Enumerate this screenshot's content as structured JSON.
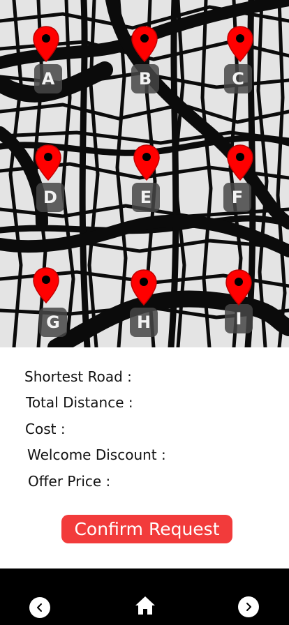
{
  "map": {
    "pins": [
      {
        "id": "a",
        "label": "A"
      },
      {
        "id": "b",
        "label": "B"
      },
      {
        "id": "c",
        "label": "C"
      },
      {
        "id": "d",
        "label": "D"
      },
      {
        "id": "e",
        "label": "E"
      },
      {
        "id": "f",
        "label": "F"
      },
      {
        "id": "g",
        "label": "G"
      },
      {
        "id": "h",
        "label": "H"
      },
      {
        "id": "i",
        "label": "I"
      }
    ],
    "pin_color": "#ff0000"
  },
  "info": {
    "shortest_road": "Shortest Road :",
    "total_distance": "Total Distance :",
    "cost": "Cost :",
    "welcome_discount": "Welcome Discount :",
    "offer_price": "Offer Price :"
  },
  "confirm_button": {
    "label": "Confirm Request",
    "color": "#f23b3b"
  },
  "navbar": {
    "back_icon": "chevron-left-icon",
    "home_icon": "home-icon",
    "forward_icon": "chevron-right-icon"
  }
}
